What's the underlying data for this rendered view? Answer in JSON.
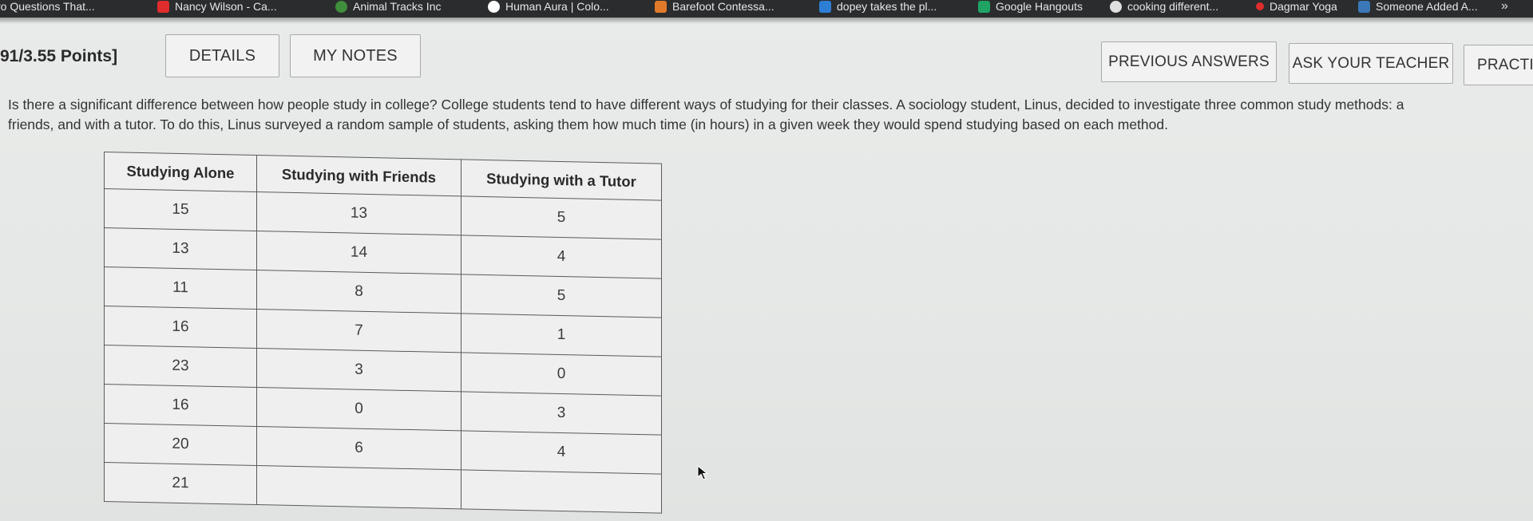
{
  "bookmarks": [
    {
      "label": "ro Questions That...",
      "icon": "bookmark-favicon",
      "color": "#2b2c2e"
    },
    {
      "label": "Nancy Wilson - Ca...",
      "icon": "youtube-icon",
      "color": "#e02c2c"
    },
    {
      "label": "Animal Tracks Inc",
      "icon": "leaf-icon",
      "color": "#3f8e3c"
    },
    {
      "label": "Human Aura | Colo...",
      "icon": "wordpress-icon",
      "color": "#ffffff"
    },
    {
      "label": "Barefoot Contessa...",
      "icon": "lg-icon",
      "color": "#e07a2a"
    },
    {
      "label": "dopey takes the pl...",
      "icon": "doc-icon",
      "color": "#2d7fd6"
    },
    {
      "label": "Google Hangouts",
      "icon": "hangouts-icon",
      "color": "#1fa463"
    },
    {
      "label": "cooking different...",
      "icon": "globe-icon",
      "color": "#e0e0e0"
    },
    {
      "label": "Dagmar Yoga",
      "icon": "youtube-icon",
      "color": "#e02c2c"
    },
    {
      "label": "Someone Added A...",
      "icon": "sunglasses-icon",
      "color": "#3a78b8"
    }
  ],
  "bookmarks_overflow": "»",
  "toolbar": {
    "points": "91/3.55 Points]",
    "details": "DETAILS",
    "my_notes": "MY NOTES",
    "previous_answers": "PREVIOUS ANSWERS",
    "ask_teacher": "ASK YOUR TEACHER",
    "practice": "PRACTIC"
  },
  "question": {
    "line1": "Is there a significant difference between how people study in college? College students tend to have different ways of studying for their classes. A sociology student, Linus, decided to investigate three common study methods: a",
    "line2": "friends, and with a tutor. To do this, Linus surveyed a random sample of students, asking them how much time (in hours) in a given week they would spend studying based on each method."
  },
  "table": {
    "headers": [
      "Studying Alone",
      "Studying with Friends",
      "Studying with a Tutor"
    ],
    "rows": [
      [
        "15",
        "13",
        "5"
      ],
      [
        "13",
        "14",
        "4"
      ],
      [
        "11",
        "8",
        "5"
      ],
      [
        "16",
        "7",
        "1"
      ],
      [
        "23",
        "3",
        "0"
      ],
      [
        "16",
        "0",
        "3"
      ],
      [
        "20",
        "6",
        "4"
      ],
      [
        "21",
        "",
        ""
      ]
    ]
  }
}
